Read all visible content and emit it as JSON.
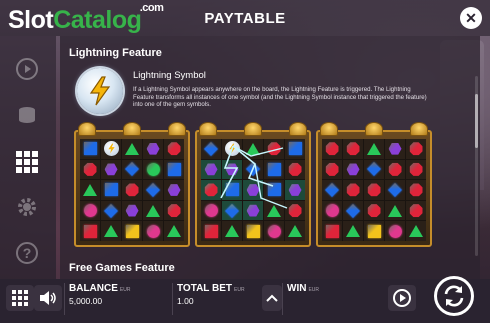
{
  "brand": {
    "logo_part1": "Slot",
    "logo_part2": "Catalog",
    "logo_suffix": ".com"
  },
  "header": {
    "title": "PAYTABLE",
    "close_icon": "close-icon"
  },
  "rail": {
    "icons": [
      "autoplay-icon",
      "coins-icon",
      "paytable-grid-icon",
      "settings-gear-icon",
      "help-question-icon"
    ],
    "active": "paytable-grid-icon"
  },
  "lightning": {
    "section_title": "Lightning Feature",
    "symbol_name": "Lightning Symbol",
    "description": "If a Lightning Symbol appears anywhere on the board, the Lightning Feature is triggered. The Lightning Feature transforms all instances of one symbol (and the Lightning Symbol instance that triggered the feature) into one of the gem symbols."
  },
  "free_games": {
    "section_title": "Free Games Feature"
  },
  "reels": [
    [
      "sq-blue",
      "lightning",
      "tri-green",
      "hex-purple",
      "oct-red",
      "oct-red",
      "hex-purple",
      "dia-blue",
      "circ-green",
      "sq-blue",
      "tri-green",
      "sq-blue",
      "oct-red",
      "dia-blue",
      "hex-purple",
      "circ-pink",
      "dia-blue",
      "hex-purple",
      "tri-green",
      "oct-red",
      "sq-red",
      "tri-green",
      "sq-yellow",
      "circ-pink",
      "tri-green"
    ],
    [
      "dia-blue",
      "lightning",
      "tri-green",
      "oct-red",
      "sq-blue",
      "hex-purple",
      "hex-purple",
      "dia-blue",
      "sq-blue",
      "oct-red",
      "oct-red",
      "sq-blue",
      "hex-purple",
      "sq-blue",
      "hex-purple",
      "circ-pink",
      "dia-blue",
      "hex-purple",
      "tri-green",
      "oct-red",
      "sq-red",
      "tri-green",
      "sq-yellow",
      "circ-pink",
      "tri-green"
    ],
    [
      "oct-red",
      "oct-red",
      "tri-green",
      "hex-purple",
      "oct-red",
      "oct-red",
      "hex-purple",
      "dia-blue",
      "oct-red",
      "oct-red",
      "dia-blue",
      "oct-red",
      "oct-red",
      "dia-blue",
      "oct-red",
      "circ-pink",
      "dia-blue",
      "oct-red",
      "tri-green",
      "oct-red",
      "sq-red",
      "tri-green",
      "sq-yellow",
      "circ-pink",
      "tri-green"
    ]
  ],
  "colors": {
    "brand_green": "#37b34a",
    "gold_frame": "#c58d2a",
    "gem_red": "#e0243a",
    "gem_blue": "#1e6be8",
    "gem_green": "#29c85a",
    "gem_purple": "#8a3fd8",
    "gem_pink": "#e0388e",
    "gem_yellow": "#f2c31c"
  },
  "bottom": {
    "menu_icon": "menu-grid-icon",
    "sound_icon": "speaker-icon",
    "balance_label": "BALANCE",
    "balance_unit": "EUR",
    "balance_value": "5,000.00",
    "totalbet_label": "TOTAL BET",
    "totalbet_unit": "EUR",
    "totalbet_value": "1.00",
    "bet_up_icon": "chevron-up-icon",
    "win_label": "WIN",
    "win_unit": "EUR",
    "win_value": "",
    "autoplay_icon": "autoplay-icon",
    "spin_icon": "spin-arrows-icon"
  }
}
